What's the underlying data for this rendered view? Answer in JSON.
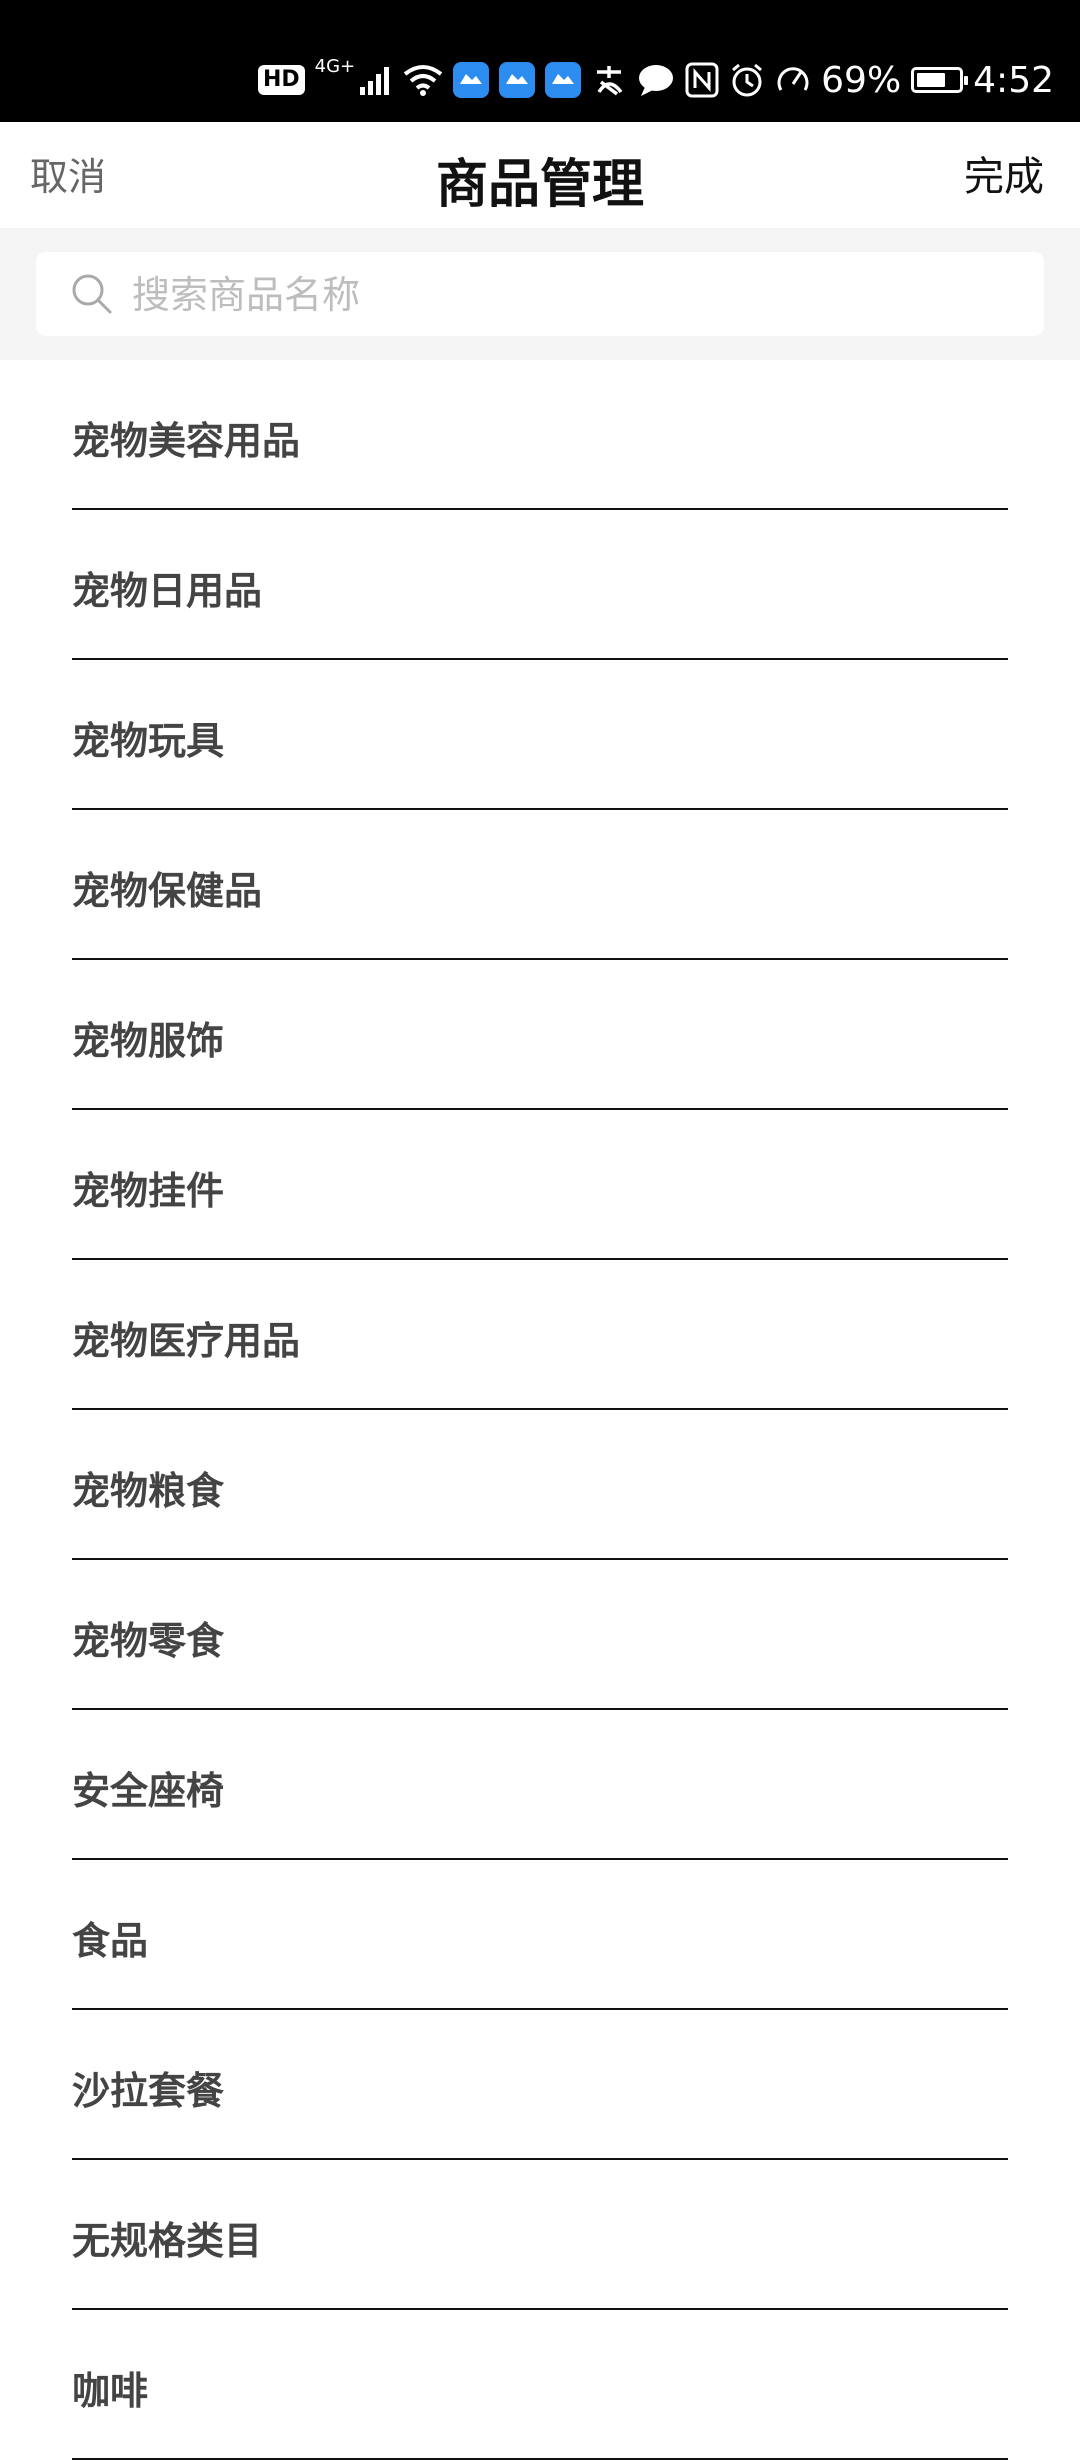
{
  "status_bar": {
    "hd": "HD",
    "network": "4G+",
    "battery_percent": "69%",
    "battery_level": 0.69,
    "time": "4:52",
    "icons": [
      "signal-icon",
      "wifi-icon",
      "app-icon",
      "app-icon",
      "app-icon",
      "pay-icon",
      "message-icon",
      "nfc-icon",
      "alarm-icon",
      "speed-icon",
      "battery-icon"
    ]
  },
  "nav": {
    "cancel": "取消",
    "title": "商品管理",
    "done": "完成"
  },
  "search": {
    "placeholder": "搜索商品名称",
    "value": ""
  },
  "categories": [
    {
      "label": "宠物美容用品"
    },
    {
      "label": "宠物日用品"
    },
    {
      "label": "宠物玩具"
    },
    {
      "label": "宠物保健品"
    },
    {
      "label": "宠物服饰"
    },
    {
      "label": "宠物挂件"
    },
    {
      "label": "宠物医疗用品"
    },
    {
      "label": "宠物粮食"
    },
    {
      "label": "宠物零食"
    },
    {
      "label": "安全座椅"
    },
    {
      "label": "食品"
    },
    {
      "label": "沙拉套餐"
    },
    {
      "label": "无规格类目"
    },
    {
      "label": "咖啡"
    }
  ]
}
